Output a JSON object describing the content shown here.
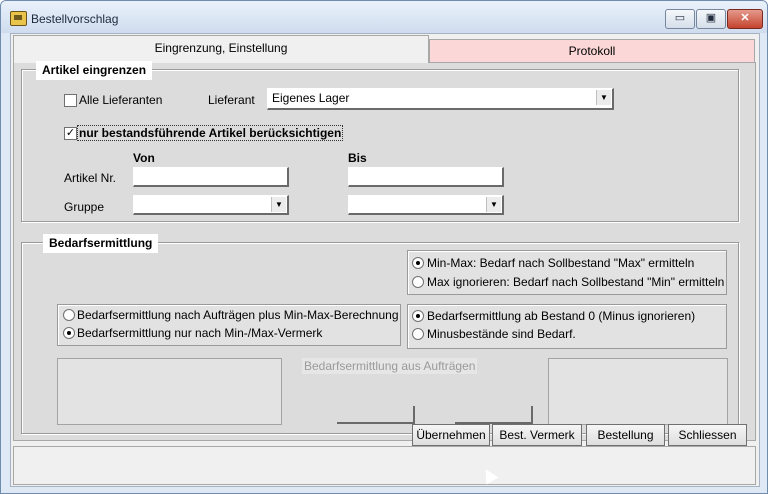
{
  "window": {
    "title": "Bestellvorschlag",
    "min": "▭",
    "max": "▣",
    "close": "✕"
  },
  "tabs": [
    "Eingrenzung, Einstellung",
    "Protokoll"
  ],
  "artikel": {
    "group_label": "Artikel eingrenzen",
    "alle_lieferanten": "Alle Lieferanten",
    "lieferant_label": "Lieferant",
    "lieferant_value": "Eigenes Lager",
    "nur_bestand": "nur bestandsführende Artikel berücksichtigen",
    "von": "Von",
    "bis": "Bis",
    "artikel_nr": "Artikel Nr.",
    "gruppe": "Gruppe"
  },
  "bedarf": {
    "group_label": "Bedarfsermittlung",
    "minmax_max": "Min-Max: Bedarf nach Sollbestand \"Max\" ermitteln",
    "max_ignore": "Max ignorieren: Bedarf nach Sollbestand \"Min\" ermitteln",
    "auftraege_plus": "Bedarfsermittlung nach Aufträgen plus Min-Max-Berechnung",
    "nur_minmax": "Bedarfsermittlung nur nach Min-/Max-Vermerk",
    "ab_bestand": "Bedarfsermittlung ab Bestand 0 (Minus ignorieren)",
    "minus": "Minusbestände sind Bedarf.",
    "aus_auftraegen": "Bedarfsermittlung aus Aufträgen"
  },
  "buttons": {
    "uebernehmen": "Übernehmen",
    "best_vermerk": "Best. Vermerk",
    "bestellung": "Bestellung",
    "schliessen": "Schliessen"
  },
  "state": {
    "alle_lieferanten_checked": false,
    "nur_bestand_checked": true,
    "selected_minmax": "Min-Max",
    "selected_auftraege": "nur Min-/Max-Vermerk",
    "selected_bestand": "ab Bestand 0"
  },
  "colors": {
    "protokoll_tab": "#fbd7d7",
    "panel": "#dcdcdc",
    "titlebar": "#dfe9f5"
  }
}
